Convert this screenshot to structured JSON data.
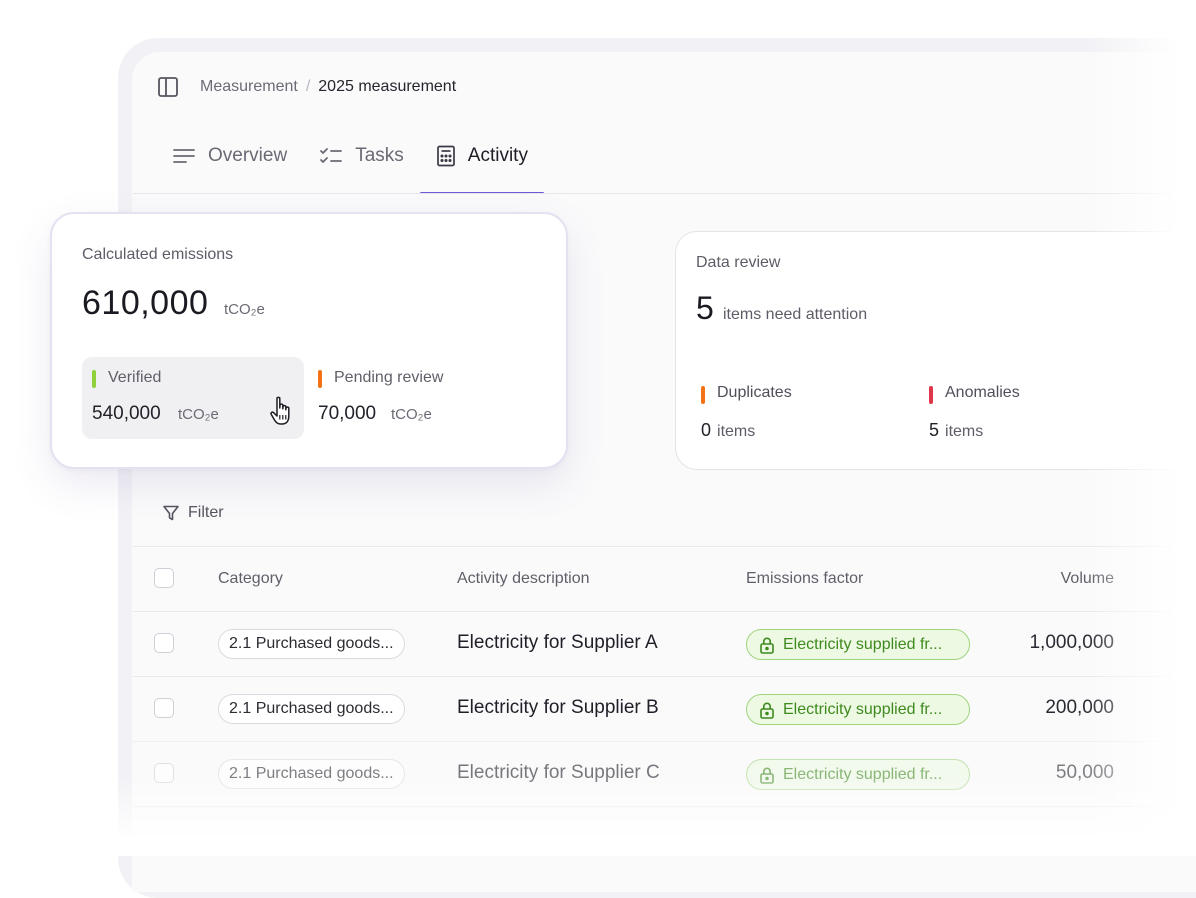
{
  "breadcrumb": {
    "parent": "Measurement",
    "separator": "/",
    "current": "2025 measurement"
  },
  "tabs": [
    {
      "label": "Overview",
      "icon": "lines-icon",
      "active": false
    },
    {
      "label": "Tasks",
      "icon": "checklist-icon",
      "active": false
    },
    {
      "label": "Activity",
      "icon": "calculator-icon",
      "active": true
    }
  ],
  "emissions": {
    "label": "Calculated emissions",
    "value": "610,000",
    "unit": "tCO₂e",
    "verified": {
      "label": "Verified",
      "value": "540,000",
      "unit": "tCO₂e",
      "color": "#8fd13a"
    },
    "pending": {
      "label": "Pending review",
      "value": "70,000",
      "unit": "tCO₂e",
      "color": "#f47216"
    }
  },
  "data_review": {
    "label": "Data review",
    "count": "5",
    "text": "items need attention",
    "duplicates": {
      "label": "Duplicates",
      "count": "0",
      "unit": "items",
      "color": "#f47216"
    },
    "anomalies": {
      "label": "Anomalies",
      "count": "5",
      "unit": "items",
      "color": "#e0364a"
    }
  },
  "filter": {
    "label": "Filter"
  },
  "table": {
    "columns": [
      "Category",
      "Activity description",
      "Emissions factor",
      "Volume"
    ],
    "rows": [
      {
        "category": "2.1 Purchased goods...",
        "description": "Electricity for Supplier A",
        "factor": "Electricity supplied fr...",
        "volume": "1,000,000"
      },
      {
        "category": "2.1 Purchased goods...",
        "description": "Electricity for Supplier B",
        "factor": "Electricity supplied fr...",
        "volume": "200,000"
      },
      {
        "category": "2.1 Purchased goods...",
        "description": "Electricity for Supplier C",
        "factor": "Electricity supplied fr...",
        "volume": "50,000"
      }
    ]
  },
  "colors": {
    "accent": "#6c5ad6",
    "verified": "#8fd13a",
    "pending": "#f47216",
    "anomaly": "#e0364a",
    "factor_chip": "#3f8a1e"
  }
}
